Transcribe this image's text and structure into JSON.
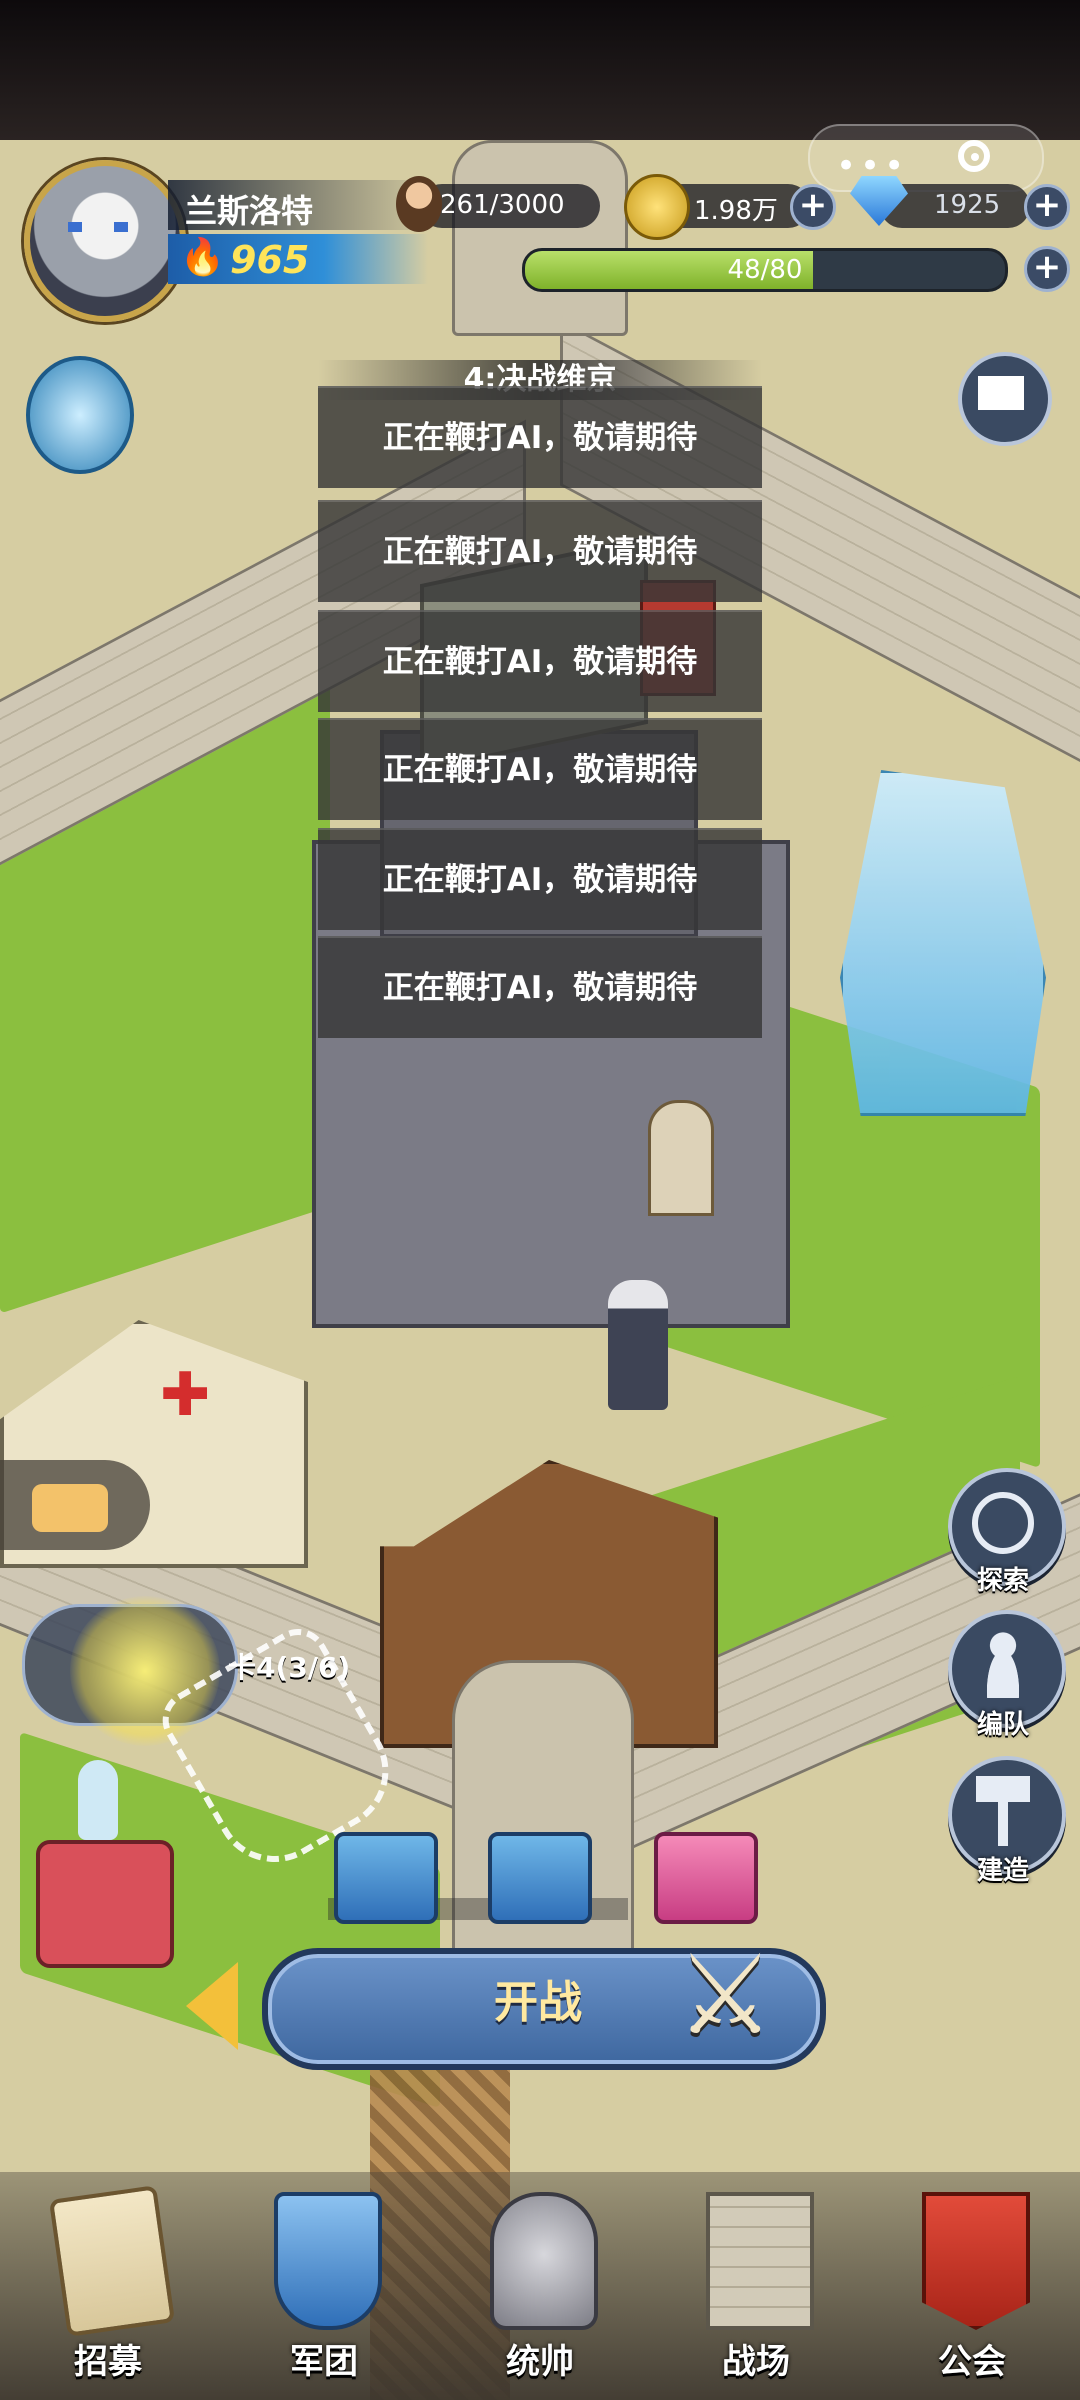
{
  "player": {
    "name": "兰斯洛特",
    "power": "965"
  },
  "resources": {
    "population": "261/3000",
    "gold": "1.98万",
    "gems": "1925",
    "stamina_text": "48/80",
    "stamina_fraction": 0.6
  },
  "menu": {
    "title": "4:决战维京",
    "items": [
      "正在鞭打AI，敬请期待",
      "正在鞭打AI，敬请期待",
      "正在鞭打AI，敬请期待",
      "正在鞭打AI，敬请期待",
      "正在鞭打AI，敬请期待",
      "正在鞭打AI，敬请期待"
    ]
  },
  "side_buttons": {
    "explore": "探索",
    "formation": "编队",
    "build": "建造"
  },
  "quest": {
    "label": "卡4(3/6)"
  },
  "battle": {
    "label": "开战"
  },
  "nav": [
    {
      "label": "招募",
      "icon": "scroll-icon"
    },
    {
      "label": "军团",
      "icon": "shield-icon"
    },
    {
      "label": "统帅",
      "icon": "helmet-icon"
    },
    {
      "label": "战场",
      "icon": "tower-icon"
    },
    {
      "label": "公会",
      "icon": "banner-icon"
    }
  ],
  "colors": {
    "accent_gold": "#ffe45a",
    "button_blue": "#3e679f",
    "grass": "#8bbf3f"
  }
}
